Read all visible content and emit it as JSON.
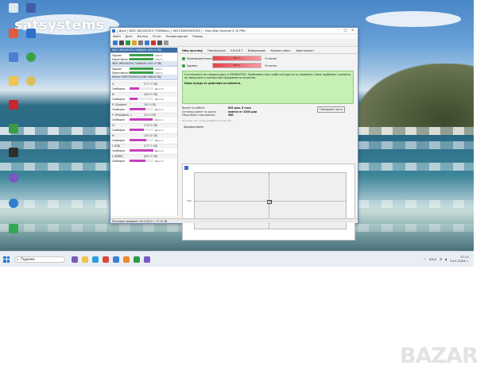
{
  "watermark": "satsystems",
  "window": {
    "title": "[ Диск ] WDC WD10EZEX (TSMN6A1) [ WD EZAMOMOOR0 ] · Hard Disk Sentinel 4.70 PRO",
    "menu": [
      "Файл",
      "Диск",
      "Изглед",
      "Отчет",
      "Конфигурация",
      "Помощ"
    ]
  },
  "disks": [
    {
      "header": "WDC WD10EZEX-75WN4A1 (931.5 GB)",
      "health_label": "Здраве",
      "health": "100 %",
      "health_pct": 100,
      "perf_label": "Ефективност",
      "perf": "100 %",
      "perf_pct": 100
    },
    {
      "header": "WDC WD10EZEX-75WN4A0 (931.5 GB)",
      "health_label": "Здраве",
      "health": "100 %",
      "health_pct": 100,
      "perf_label": "Ефективност",
      "perf": "100 %",
      "perf_pct": 100
    },
    {
      "header": "Hitachi HDP725050GLA360 (465.8 GB)",
      "health_label": "",
      "health": "",
      "health_pct": 0,
      "perf_label": "",
      "perf": "",
      "perf_pct": 0
    }
  ],
  "partitions": [
    {
      "name": "C:",
      "size": "(277.7 GB)",
      "free_label": "Свободни",
      "free": "108.9 GB",
      "pct": 39,
      "disk": "Диск 0"
    },
    {
      "name": "D:",
      "size": "(653.5 GB)",
      "free_label": "Свободни",
      "free": "216.3 GB",
      "pct": 33,
      "disk": "Диск 0"
    },
    {
      "name": "E: (System)",
      "size": "(50.0 GB)",
      "free_label": "Свободни",
      "free": "32.5 GB",
      "pct": 65,
      "disk": "Диск 1"
    },
    {
      "name": "F: (Резервни...)",
      "size": "(51.9 GB)",
      "free_label": "Свободни",
      "free": "51.0 GB",
      "pct": 98,
      "disk": "Диск 1"
    },
    {
      "name": "G:",
      "size": "(270.4 GB)",
      "free_label": "Свободни",
      "free": "163.6 GB",
      "pct": 60,
      "disk": "Диск 1"
    },
    {
      "name": "H:",
      "size": "(253.8 GB)",
      "free_label": "Свободни",
      "free": "174.6 GB",
      "pct": 69,
      "disk": "Диск 1"
    },
    {
      "name": "I: (DR)",
      "size": "(277.7 GB)",
      "free_label": "Свободни",
      "free": "274.6 GB",
      "pct": 99,
      "disk": "Диск 2"
    },
    {
      "name": "J: (DATA)",
      "size": "(651.3 GB)",
      "free_label": "Свободни",
      "free": "437.6 GB",
      "pct": 67,
      "disk": "Диск 2"
    }
  ],
  "tabs": [
    "Общ преглед",
    "Температура",
    "S.M.A.R.T.",
    "Информация",
    "Журнал събит.",
    "Ефективност"
  ],
  "metrics": [
    {
      "label": "Производителност:",
      "value": "100 %",
      "pct": 100,
      "status": "Отлично"
    },
    {
      "label": "Здраве:",
      "value": "100 %",
      "pct": 100,
      "status": "Отлично"
    }
  ],
  "panel": {
    "text": "Състоянието на твърдия диск е ПЕРФЕКТНО. Проблемни или слаби сектори не са намерени. Няма проблеми с времето на завъртане и грешки при предаването на данни.",
    "advice": "Няма нужда от действия за момента."
  },
  "info": {
    "rows": [
      {
        "label": "Време на работа:",
        "value": "883 дни, 8 часа"
      },
      {
        "label": "Оставащ живот на диска:",
        "value": "повече от 1000 дни"
      },
      {
        "label": "Общо брой стартирания:",
        "value": "380"
      }
    ],
    "test_button": "Повтаряне теста"
  },
  "small_link": "Натисни тук, за да добавите коментар...",
  "section_title": "Здравословно",
  "chart_data": {
    "type": "line",
    "title": "",
    "ylabel": "100",
    "series": [
      {
        "values": [
          100
        ]
      }
    ]
  },
  "statusbar": "Последна проверка: 24.4.2024 г., 17:12:38",
  "taskbar": {
    "search_placeholder": "Търсене",
    "lang": "БЪЛ",
    "time": "17:12",
    "date": "24.4.2024 г."
  },
  "colors": {
    "accent": "#2a7ad6",
    "good": "#2e9a41",
    "panel_green": "#c6f0b4",
    "partition_bar": "#c83dbb",
    "health_bar": "#3c9f4a"
  },
  "bazar_logo": "BAZAR"
}
